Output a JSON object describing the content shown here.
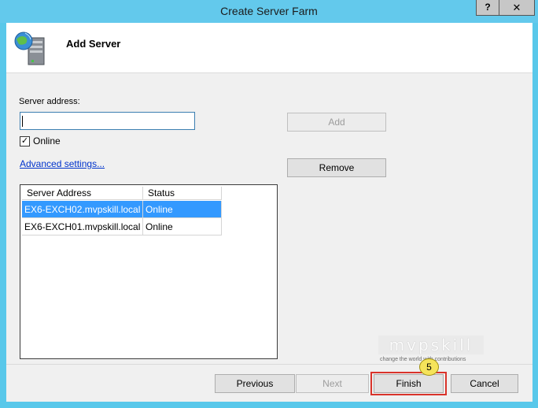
{
  "window": {
    "title": "Create Server Farm",
    "help_label": "?",
    "close_label": "✕"
  },
  "header": {
    "title": "Add Server",
    "icon": "server-globe-icon"
  },
  "form": {
    "address_label": "Server address:",
    "address_value": "",
    "online_label": "Online",
    "online_checked": true,
    "advanced_link": "Advanced settings...",
    "add_button": "Add",
    "remove_button": "Remove"
  },
  "server_list": {
    "columns": [
      "Server Address",
      "Status"
    ],
    "rows": [
      {
        "address": "EX6-EXCH02.mvpskill.local",
        "status": "Online",
        "selected": true
      },
      {
        "address": "EX6-EXCH01.mvpskill.local",
        "status": "Online",
        "selected": false
      }
    ]
  },
  "footer": {
    "previous": "Previous",
    "next": "Next",
    "finish": "Finish",
    "cancel": "Cancel"
  },
  "annotation": {
    "step_number": "5",
    "highlight_color": "#d9332b",
    "badge_color": "#f5e35a"
  },
  "watermark": {
    "brand": "mvpskill",
    "tagline": "change the world with contributions"
  },
  "colors": {
    "titlebar": "#63c9ec",
    "selection": "#3399ff",
    "link": "#0033cc"
  }
}
